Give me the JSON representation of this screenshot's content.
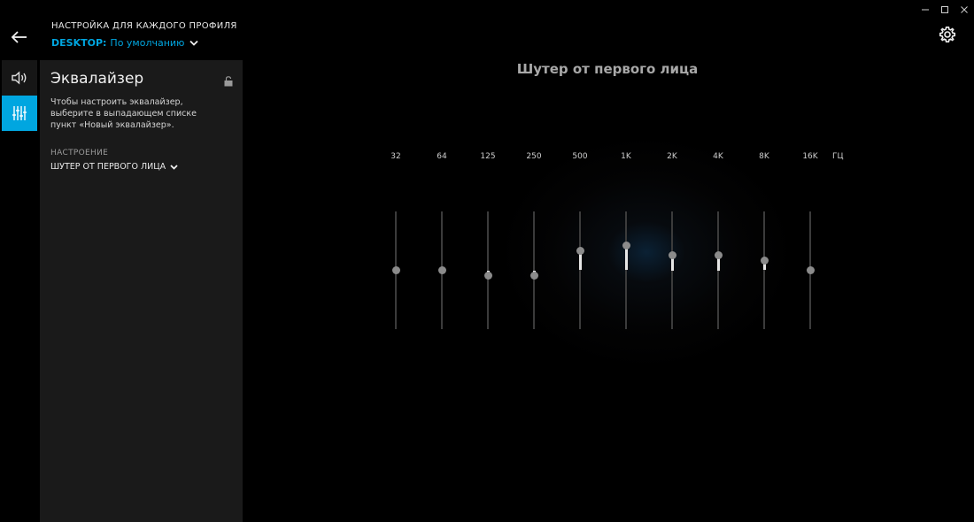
{
  "window": {
    "controls": [
      "minimize-icon",
      "maximize-icon",
      "close-icon"
    ]
  },
  "header": {
    "caption": "НАСТРОЙКА ДЛЯ КАЖДОГО ПРОФИЛЯ",
    "device": "DESKTOP:",
    "profile_name": "По умолчанию",
    "back_icon": "arrow-left-icon",
    "settings_icon": "gear-icon"
  },
  "rail": {
    "items": [
      {
        "id": "sound",
        "icon": "speaker-icon",
        "active": false
      },
      {
        "id": "equalizer",
        "icon": "equalizer-icon",
        "active": true
      }
    ]
  },
  "panel": {
    "title": "Эквалайзер",
    "description": "Чтобы настроить эквалайзер, выберите в выпадающем списке пункт «Новый эквалайзер».",
    "preset_label": "НАСТРОЕНИЕ",
    "preset_value": "ШУТЕР ОТ ПЕРВОГО ЛИЦА",
    "lock_icon": "unlock-icon"
  },
  "equalizer": {
    "title": "Шутер от первого лица",
    "unit": "ГЦ",
    "range_db": [
      -12,
      12
    ],
    "bands": [
      {
        "label": "32",
        "gain": 0
      },
      {
        "label": "64",
        "gain": 0
      },
      {
        "label": "125",
        "gain": -1
      },
      {
        "label": "250",
        "gain": -1
      },
      {
        "label": "500",
        "gain": 4
      },
      {
        "label": "1K",
        "gain": 5
      },
      {
        "label": "2K",
        "gain": 3
      },
      {
        "label": "4K",
        "gain": 3
      },
      {
        "label": "8K",
        "gain": 2
      },
      {
        "label": "16K",
        "gain": 0
      }
    ]
  },
  "colors": {
    "accent": "#00a6e0",
    "panel_bg": "#1a1a1a",
    "track": "#3b3b3b",
    "knob": "#8b8b8b"
  }
}
